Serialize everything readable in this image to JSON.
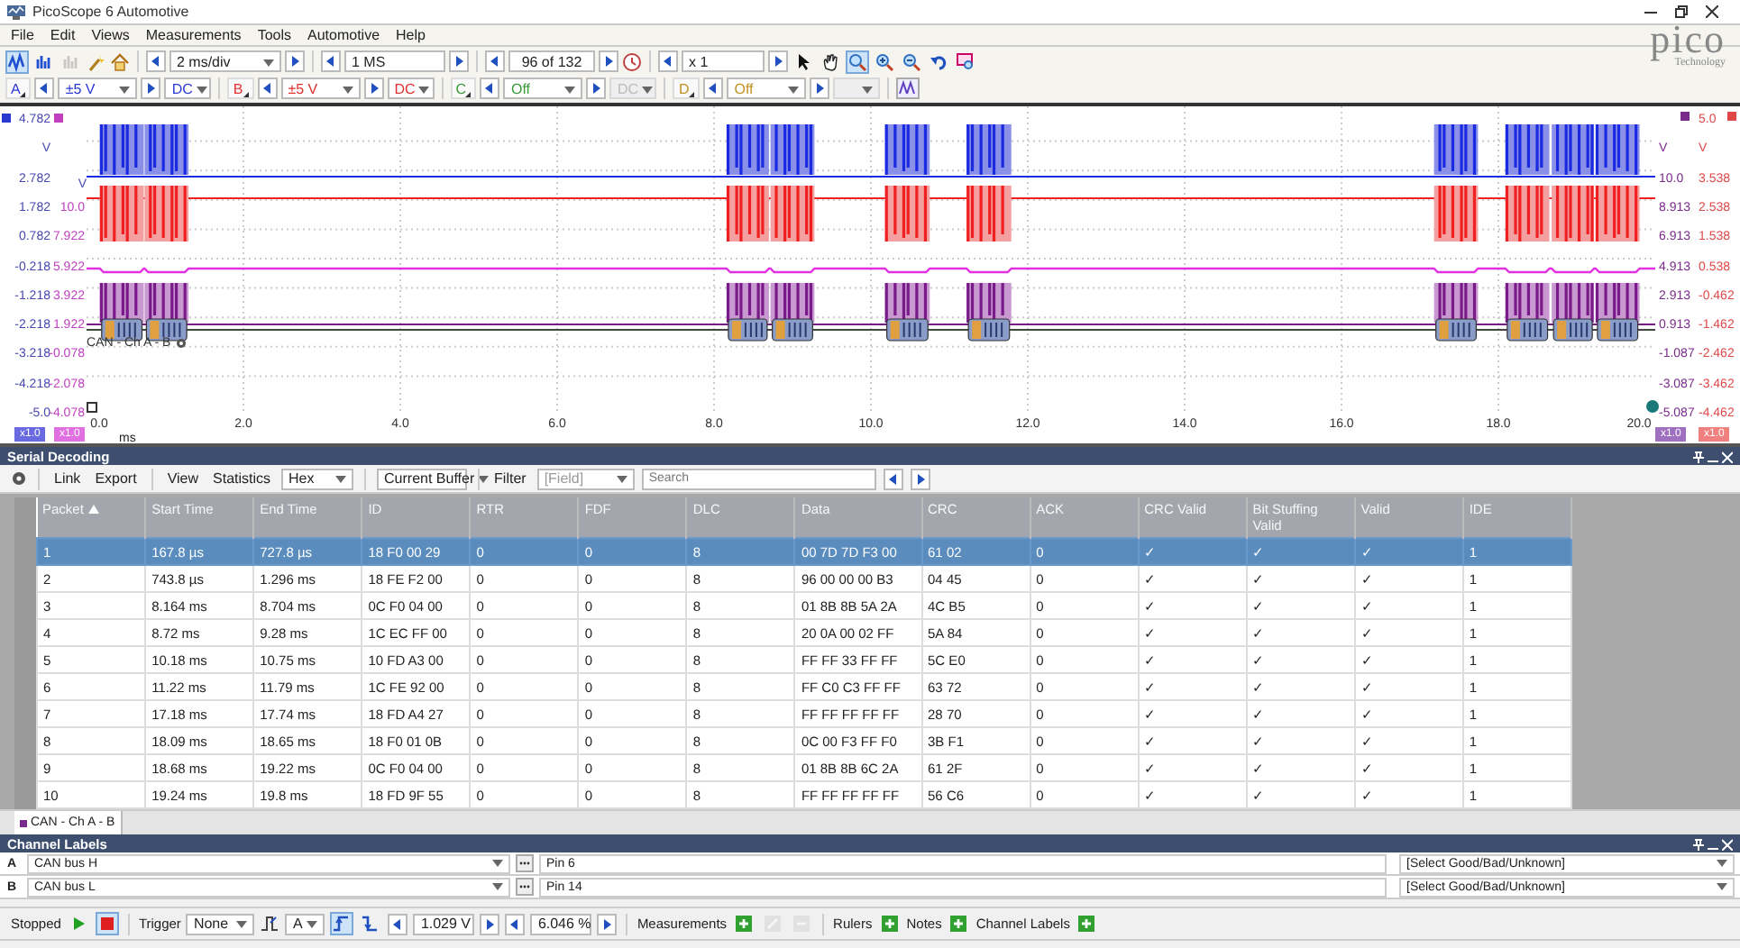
{
  "window": {
    "title": "PicoScope 6 Automotive"
  },
  "menu": [
    "File",
    "Edit",
    "Views",
    "Measurements",
    "Tools",
    "Automotive",
    "Help"
  ],
  "toolbar": {
    "view_modes": [
      {
        "kind": "scope",
        "selected": true,
        "disabled": false
      },
      {
        "kind": "spectrum",
        "selected": false,
        "disabled": false
      },
      {
        "kind": "persistence",
        "selected": false,
        "disabled": true
      }
    ],
    "timebase": "2 ms/div",
    "samples": "1 MS",
    "buffer": "96 of 132",
    "zoom": "x 1",
    "tools": [
      {
        "kind": "pointer",
        "selected": false
      },
      {
        "kind": "hand",
        "selected": false
      },
      {
        "kind": "zoom-box",
        "selected": true
      },
      {
        "kind": "zoom-in",
        "selected": false
      },
      {
        "kind": "zoom-out",
        "selected": false
      },
      {
        "kind": "undo",
        "selected": false
      },
      {
        "kind": "zoom-fit",
        "selected": false
      }
    ]
  },
  "channels": [
    {
      "name": "A",
      "range": "±5 V",
      "coupling": "DC",
      "enabled": true,
      "color": "#2a3ad0"
    },
    {
      "name": "B",
      "range": "±5 V",
      "coupling": "DC",
      "enabled": true,
      "color": "#e03030"
    },
    {
      "name": "C",
      "range": "Off",
      "coupling": "DC",
      "enabled": false,
      "color": "#3a9a3a"
    },
    {
      "name": "D",
      "range": "Off",
      "enabled": false,
      "color": "#c09020"
    }
  ],
  "logo": {
    "name": "pico",
    "tagline": "Technology"
  },
  "scope": {
    "axes_left": [
      {
        "color": "#4848b0",
        "labels": [
          "4.782",
          "V",
          "2.782",
          "1.782",
          "0.782",
          "-0.218",
          "-1.218",
          "-2.218",
          "-3.218",
          "-4.218",
          "-5.0"
        ]
      },
      {
        "color": "#c040c0",
        "labels": [
          "10.0",
          "7.922",
          "5.922",
          "3.922",
          "1.922",
          "-0.078",
          "-2.078",
          "-4.078"
        ]
      }
    ],
    "axes_right": [
      {
        "color": "#7a2a8a",
        "labels": [
          "V",
          "10.0",
          "8.913",
          "6.913",
          "4.913",
          "2.913",
          "0.913",
          "-1.087",
          "-3.087",
          "-5.087"
        ]
      },
      {
        "color": "#e04848",
        "labels": [
          "5.0",
          "V",
          "3.538",
          "2.538",
          "1.538",
          "0.538",
          "-0.462",
          "-1.462",
          "-2.462",
          "-3.462",
          "-4.462"
        ]
      }
    ],
    "offset_label": "V",
    "x_ticks": [
      "0.0",
      "2.0",
      "4.0",
      "6.0",
      "8.0",
      "10.0",
      "12.0",
      "14.0",
      "16.0",
      "18.0",
      "20.0"
    ],
    "x_unit": "ms",
    "badges_left": [
      {
        "text": "x1.0",
        "color": "#6a6ae0"
      },
      {
        "text": "x1.0",
        "color": "#e070e0"
      }
    ],
    "badges_right": [
      {
        "text": "x1.0",
        "color": "#a070c0"
      },
      {
        "text": "x1.0",
        "color": "#f08080"
      }
    ],
    "decode_label": "CAN - Ch A - B"
  },
  "serial_decoding": {
    "title": "Serial Decoding",
    "toolbar": {
      "link": "Link",
      "export": "Export",
      "view": "View",
      "statistics": "Statistics",
      "format": "Hex",
      "buffer": "Current Buffer",
      "filter": "Filter",
      "field": "[Field]",
      "search_placeholder": "Search"
    },
    "columns": [
      {
        "label": "Packet",
        "sorted": true
      },
      {
        "label": "Start Time",
        "sorted": false
      },
      {
        "label": "End Time",
        "sorted": false
      },
      {
        "label": "ID",
        "sorted": false
      },
      {
        "label": "RTR",
        "sorted": false
      },
      {
        "label": "FDF",
        "sorted": false
      },
      {
        "label": "DLC",
        "sorted": false
      },
      {
        "label": "Data",
        "sorted": false
      },
      {
        "label": "CRC",
        "sorted": false
      },
      {
        "label": "ACK",
        "sorted": false
      },
      {
        "label": "CRC Valid",
        "sorted": false
      },
      {
        "label": "Bit Stuffing Valid",
        "sorted": false
      },
      {
        "label": "Valid",
        "sorted": false
      },
      {
        "label": "IDE",
        "sorted": false
      }
    ],
    "rows": [
      {
        "selected": true,
        "cells": [
          "1",
          "167.8 µs",
          "727.8 µs",
          "18 F0 00 29",
          "0",
          "0",
          "8",
          "00 7D 7D F3 00",
          "61 02",
          "0",
          "✓",
          "✓",
          "✓",
          "1"
        ]
      },
      {
        "selected": false,
        "cells": [
          "2",
          "743.8 µs",
          "1.296 ms",
          "18 FE F2 00",
          "0",
          "0",
          "8",
          "96 00 00 00 B3",
          "04 45",
          "0",
          "✓",
          "✓",
          "✓",
          "1"
        ]
      },
      {
        "selected": false,
        "cells": [
          "3",
          "8.164 ms",
          "8.704 ms",
          "0C F0 04 00",
          "0",
          "0",
          "8",
          "01 8B 8B 5A 2A",
          "4C B5",
          "0",
          "✓",
          "✓",
          "✓",
          "1"
        ]
      },
      {
        "selected": false,
        "cells": [
          "4",
          "8.72 ms",
          "9.28 ms",
          "1C EC FF 00",
          "0",
          "0",
          "8",
          "20 0A 00 02 FF",
          "5A 84",
          "0",
          "✓",
          "✓",
          "✓",
          "1"
        ]
      },
      {
        "selected": false,
        "cells": [
          "5",
          "10.18 ms",
          "10.75 ms",
          "10 FD A3 00",
          "0",
          "0",
          "8",
          "FF FF 33 FF FF",
          "5C E0",
          "0",
          "✓",
          "✓",
          "✓",
          "1"
        ]
      },
      {
        "selected": false,
        "cells": [
          "6",
          "11.22 ms",
          "11.79 ms",
          "1C FE 92 00",
          "0",
          "0",
          "8",
          "FF C0 C3 FF FF",
          "63 72",
          "0",
          "✓",
          "✓",
          "✓",
          "1"
        ]
      },
      {
        "selected": false,
        "cells": [
          "7",
          "17.18 ms",
          "17.74 ms",
          "18 FD A4 27",
          "0",
          "0",
          "8",
          "FF FF FF FF FF",
          "28 70",
          "0",
          "✓",
          "✓",
          "✓",
          "1"
        ]
      },
      {
        "selected": false,
        "cells": [
          "8",
          "18.09 ms",
          "18.65 ms",
          "18 F0 01 0B",
          "0",
          "0",
          "8",
          "0C 00 F3 FF F0",
          "3B F1",
          "0",
          "✓",
          "✓",
          "✓",
          "1"
        ]
      },
      {
        "selected": false,
        "cells": [
          "9",
          "18.68 ms",
          "19.22 ms",
          "0C F0 04 00",
          "0",
          "0",
          "8",
          "01 8B 8B 6C 2A",
          "61 2F",
          "0",
          "✓",
          "✓",
          "✓",
          "1"
        ]
      },
      {
        "selected": false,
        "cells": [
          "10",
          "19.24 ms",
          "19.8 ms",
          "18 FD 9F 55",
          "0",
          "0",
          "8",
          "FF FF FF FF FF",
          "56 C6",
          "0",
          "✓",
          "✓",
          "✓",
          "1"
        ]
      }
    ],
    "tabs": [
      {
        "label": "CAN - Ch A - B",
        "selected": true
      }
    ]
  },
  "channel_labels": {
    "title": "Channel Labels",
    "rows": [
      {
        "channel": "A",
        "label": "CAN bus H",
        "pin": "Pin 6",
        "status": "[Select Good/Bad/Unknown]"
      },
      {
        "channel": "B",
        "label": "CAN bus L",
        "pin": "Pin 14",
        "status": "[Select Good/Bad/Unknown]"
      }
    ]
  },
  "status_bar": {
    "state": "Stopped",
    "run_controls": [
      {
        "kind": "run",
        "selected": false
      },
      {
        "kind": "stop",
        "selected": true
      }
    ],
    "trigger_label": "Trigger",
    "trigger_mode": "None",
    "trigger_channel": "A",
    "edges": [
      {
        "kind": "rising",
        "selected": true
      },
      {
        "kind": "falling",
        "selected": false
      }
    ],
    "threshold": "1.029 V",
    "pretrigger": "6.046 %",
    "measurements": "Measurements",
    "measurement_buttons": [
      {
        "kind": "add",
        "disabled": false
      },
      {
        "kind": "edit",
        "disabled": true
      },
      {
        "kind": "delete",
        "disabled": true
      }
    ],
    "rulers": "Rulers",
    "notes": "Notes",
    "channel_labels": "Channel Labels"
  }
}
